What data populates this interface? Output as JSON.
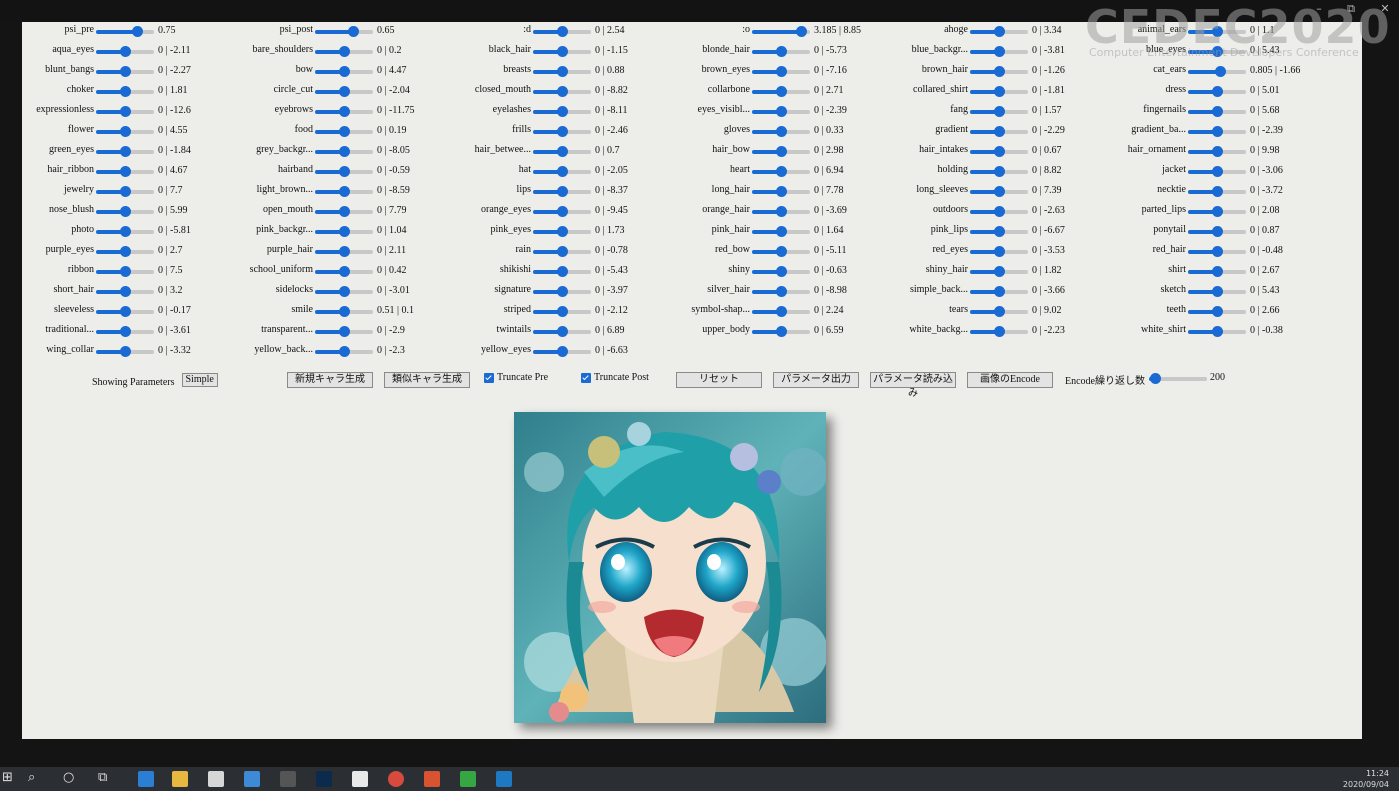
{
  "window_controls": {
    "minimize": "–",
    "maximize": "⧉",
    "close": "✕"
  },
  "watermark": {
    "logo": "CEDEC2020",
    "subtitle": "Computer Entertainment Developers Conference"
  },
  "columns": [
    [
      {
        "label": "psi_pre",
        "value": "0.75",
        "pos": 0.7
      },
      {
        "label": "aqua_eyes",
        "value": "0 | -2.11",
        "pos": 0.5
      },
      {
        "label": "blunt_bangs",
        "value": "0 | -2.27",
        "pos": 0.5
      },
      {
        "label": "choker",
        "value": "0 | 1.81",
        "pos": 0.5
      },
      {
        "label": "expressionless",
        "value": "0 | -12.6",
        "pos": 0.5
      },
      {
        "label": "flower",
        "value": "0 | 4.55",
        "pos": 0.5
      },
      {
        "label": "green_eyes",
        "value": "0 | -1.84",
        "pos": 0.5
      },
      {
        "label": "hair_ribbon",
        "value": "0 | 4.67",
        "pos": 0.5
      },
      {
        "label": "jewelry",
        "value": "0 | 7.7",
        "pos": 0.5
      },
      {
        "label": "nose_blush",
        "value": "0 | 5.99",
        "pos": 0.5
      },
      {
        "label": "photo",
        "value": "0 | -5.81",
        "pos": 0.5
      },
      {
        "label": "purple_eyes",
        "value": "0 | 2.7",
        "pos": 0.5
      },
      {
        "label": "ribbon",
        "value": "0 | 7.5",
        "pos": 0.5
      },
      {
        "label": "short_hair",
        "value": "0 | 3.2",
        "pos": 0.5
      },
      {
        "label": "sleeveless",
        "value": "0 | -0.17",
        "pos": 0.5
      },
      {
        "label": "traditional...",
        "value": "0 | -3.61",
        "pos": 0.5
      },
      {
        "label": "wing_collar",
        "value": "0 | -3.32",
        "pos": 0.5
      }
    ],
    [
      {
        "label": "psi_post",
        "value": "0.65",
        "pos": 0.65
      },
      {
        "label": "bare_shoulders",
        "value": "0 | 0.2",
        "pos": 0.5
      },
      {
        "label": "bow",
        "value": "0 | 4.47",
        "pos": 0.5
      },
      {
        "label": "circle_cut",
        "value": "0 | -2.04",
        "pos": 0.5
      },
      {
        "label": "eyebrows",
        "value": "0 | -11.75",
        "pos": 0.5
      },
      {
        "label": "food",
        "value": "0 | 0.19",
        "pos": 0.5
      },
      {
        "label": "grey_backgr...",
        "value": "0 | -8.05",
        "pos": 0.5
      },
      {
        "label": "hairband",
        "value": "0 | -0.59",
        "pos": 0.5
      },
      {
        "label": "light_brown...",
        "value": "0 | -8.59",
        "pos": 0.5
      },
      {
        "label": "open_mouth",
        "value": "0 | 7.79",
        "pos": 0.5
      },
      {
        "label": "pink_backgr...",
        "value": "0 | 1.04",
        "pos": 0.5
      },
      {
        "label": "purple_hair",
        "value": "0 | 2.11",
        "pos": 0.5
      },
      {
        "label": "school_uniform",
        "value": "0 | 0.42",
        "pos": 0.5
      },
      {
        "label": "sidelocks",
        "value": "0 | -3.01",
        "pos": 0.5
      },
      {
        "label": "smile",
        "value": "0.51 | 0.1",
        "pos": 0.5
      },
      {
        "label": "transparent...",
        "value": "0 | -2.9",
        "pos": 0.5
      },
      {
        "label": "yellow_back...",
        "value": "0 | -2.3",
        "pos": 0.5
      }
    ],
    [
      {
        "label": ":d",
        "value": "0 | 2.54",
        "pos": 0.5
      },
      {
        "label": "black_hair",
        "value": "0 | -1.15",
        "pos": 0.5
      },
      {
        "label": "breasts",
        "value": "0 | 0.88",
        "pos": 0.5
      },
      {
        "label": "closed_mouth",
        "value": "0 | -8.82",
        "pos": 0.5
      },
      {
        "label": "eyelashes",
        "value": "0 | -8.11",
        "pos": 0.5
      },
      {
        "label": "frills",
        "value": "0 | -2.46",
        "pos": 0.5
      },
      {
        "label": "hair_betwee...",
        "value": "0 | 0.7",
        "pos": 0.5
      },
      {
        "label": "hat",
        "value": "0 | -2.05",
        "pos": 0.5
      },
      {
        "label": "lips",
        "value": "0 | -8.37",
        "pos": 0.5
      },
      {
        "label": "orange_eyes",
        "value": "0 | -9.45",
        "pos": 0.5
      },
      {
        "label": "pink_eyes",
        "value": "0 | 1.73",
        "pos": 0.5
      },
      {
        "label": "rain",
        "value": "0 | -0.78",
        "pos": 0.5
      },
      {
        "label": "shikishi",
        "value": "0 | -5.43",
        "pos": 0.5
      },
      {
        "label": "signature",
        "value": "0 | -3.97",
        "pos": 0.5
      },
      {
        "label": "striped",
        "value": "0 | -2.12",
        "pos": 0.5
      },
      {
        "label": "twintails",
        "value": "0 | 6.89",
        "pos": 0.5
      },
      {
        "label": "yellow_eyes",
        "value": "0 | -6.63",
        "pos": 0.5
      }
    ],
    [
      {
        "label": ":o",
        "value": "3.185 | 8.85",
        "pos": 0.85
      },
      {
        "label": "blonde_hair",
        "value": "0 | -5.73",
        "pos": 0.5
      },
      {
        "label": "brown_eyes",
        "value": "0 | -7.16",
        "pos": 0.5
      },
      {
        "label": "collarbone",
        "value": "0 | 2.71",
        "pos": 0.5
      },
      {
        "label": "eyes_visibl...",
        "value": "0 | -2.39",
        "pos": 0.5
      },
      {
        "label": "gloves",
        "value": "0 | 0.33",
        "pos": 0.5
      },
      {
        "label": "hair_bow",
        "value": "0 | 2.98",
        "pos": 0.5
      },
      {
        "label": "heart",
        "value": "0 | 6.94",
        "pos": 0.5
      },
      {
        "label": "long_hair",
        "value": "0 | 7.78",
        "pos": 0.5
      },
      {
        "label": "orange_hair",
        "value": "0 | -3.69",
        "pos": 0.5
      },
      {
        "label": "pink_hair",
        "value": "0 | 1.64",
        "pos": 0.5
      },
      {
        "label": "red_bow",
        "value": "0 | -5.11",
        "pos": 0.5
      },
      {
        "label": "shiny",
        "value": "0 | -0.63",
        "pos": 0.5
      },
      {
        "label": "silver_hair",
        "value": "0 | -8.98",
        "pos": 0.5
      },
      {
        "label": "symbol-shap...",
        "value": "0 | 2.24",
        "pos": 0.5
      },
      {
        "label": "upper_body",
        "value": "0 | 6.59",
        "pos": 0.5
      }
    ],
    [
      {
        "label": "ahoge",
        "value": "0 | 3.34",
        "pos": 0.5
      },
      {
        "label": "blue_backgr...",
        "value": "0 | -3.81",
        "pos": 0.5
      },
      {
        "label": "brown_hair",
        "value": "0 | -1.26",
        "pos": 0.5
      },
      {
        "label": "collared_shirt",
        "value": "0 | -1.81",
        "pos": 0.5
      },
      {
        "label": "fang",
        "value": "0 | 1.57",
        "pos": 0.5
      },
      {
        "label": "gradient",
        "value": "0 | -2.29",
        "pos": 0.5
      },
      {
        "label": "hair_intakes",
        "value": "0 | 0.67",
        "pos": 0.5
      },
      {
        "label": "holding",
        "value": "0 | 8.82",
        "pos": 0.5
      },
      {
        "label": "long_sleeves",
        "value": "0 | 7.39",
        "pos": 0.5
      },
      {
        "label": "outdoors",
        "value": "0 | -2.63",
        "pos": 0.5
      },
      {
        "label": "pink_lips",
        "value": "0 | -6.67",
        "pos": 0.5
      },
      {
        "label": "red_eyes",
        "value": "0 | -3.53",
        "pos": 0.5
      },
      {
        "label": "shiny_hair",
        "value": "0 | 1.82",
        "pos": 0.5
      },
      {
        "label": "simple_back...",
        "value": "0 | -3.66",
        "pos": 0.5
      },
      {
        "label": "tears",
        "value": "0 | 9.02",
        "pos": 0.5
      },
      {
        "label": "white_backg...",
        "value": "0 | -2.23",
        "pos": 0.5
      }
    ],
    [
      {
        "label": "animal_ears",
        "value": "0 | 1.1",
        "pos": 0.5
      },
      {
        "label": "blue_eyes",
        "value": "0 | 5.43",
        "pos": 0.5
      },
      {
        "label": "cat_ears",
        "value": "0.805 | -1.66",
        "pos": 0.55
      },
      {
        "label": "dress",
        "value": "0 | 5.01",
        "pos": 0.5
      },
      {
        "label": "fingernails",
        "value": "0 | 5.68",
        "pos": 0.5
      },
      {
        "label": "gradient_ba...",
        "value": "0 | -2.39",
        "pos": 0.5
      },
      {
        "label": "hair_ornament",
        "value": "0 | 9.98",
        "pos": 0.5
      },
      {
        "label": "jacket",
        "value": "0 | -3.06",
        "pos": 0.5
      },
      {
        "label": "necktie",
        "value": "0 | -3.72",
        "pos": 0.5
      },
      {
        "label": "parted_lips",
        "value": "0 | 2.08",
        "pos": 0.5
      },
      {
        "label": "ponytail",
        "value": "0 | 0.87",
        "pos": 0.5
      },
      {
        "label": "red_hair",
        "value": "0 | -0.48",
        "pos": 0.5
      },
      {
        "label": "shirt",
        "value": "0 | 2.67",
        "pos": 0.5
      },
      {
        "label": "sketch",
        "value": "0 | 5.43",
        "pos": 0.5
      },
      {
        "label": "teeth",
        "value": "0 | 2.66",
        "pos": 0.5
      },
      {
        "label": "white_shirt",
        "value": "0 | -0.38",
        "pos": 0.5
      }
    ]
  ],
  "controls": {
    "showing_label": "Showing Parameters",
    "simple_button": "Simple",
    "new_char_button": "新規キャラ生成",
    "similar_char_button": "類似キャラ生成",
    "truncate_pre": "Truncate Pre",
    "truncate_post": "Truncate Post",
    "reset_button": "リセット",
    "param_export_button": "パラメータ出力",
    "param_import_button": "パラメータ読み込み",
    "encode_button": "画像のEncode",
    "encode_iter_label": "Encode繰り返し数",
    "encode_iter_value": "200",
    "encode_iter_pos": 0.1
  },
  "taskbar": {
    "time": "11:24",
    "date": "2020/09/04"
  },
  "colors": {
    "accent": "#1a6ad4",
    "panel": "#ededea",
    "taskbar": "#2b2e33"
  }
}
